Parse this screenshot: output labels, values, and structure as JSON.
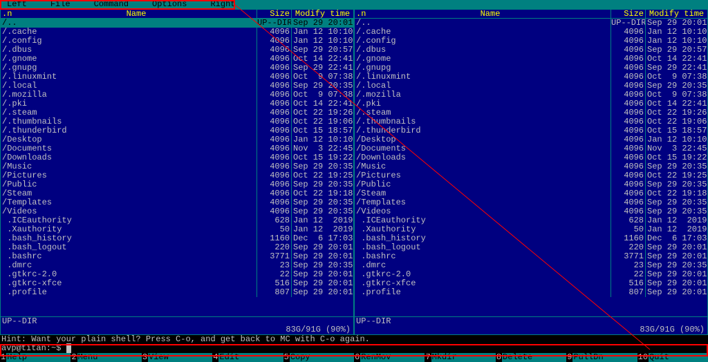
{
  "menu": [
    "Left",
    "File",
    "Command",
    "Options",
    "Right"
  ],
  "header": {
    "n": ".n",
    "name": "Name",
    "size": "Size",
    "date": "Modify time",
    "corner": ".[^]>"
  },
  "files": [
    {
      "name": "/..",
      "size": "UP--DIR",
      "date": "Sep 29 20:01",
      "sel": true
    },
    {
      "name": "/.cache",
      "size": "4096",
      "date": "Jan 12 10:10"
    },
    {
      "name": "/.config",
      "size": "4096",
      "date": "Jan 12 10:10"
    },
    {
      "name": "/.dbus",
      "size": "4096",
      "date": "Sep 29 20:57"
    },
    {
      "name": "/.gnome",
      "size": "4096",
      "date": "Oct 14 22:41"
    },
    {
      "name": "/.gnupg",
      "size": "4096",
      "date": "Sep 29 22:41"
    },
    {
      "name": "/.linuxmint",
      "size": "4096",
      "date": "Oct  9 07:38"
    },
    {
      "name": "/.local",
      "size": "4096",
      "date": "Sep 29 20:35"
    },
    {
      "name": "/.mozilla",
      "size": "4096",
      "date": "Oct  9 07:38"
    },
    {
      "name": "/.pki",
      "size": "4096",
      "date": "Oct 14 22:41"
    },
    {
      "name": "/.steam",
      "size": "4096",
      "date": "Oct 22 19:26"
    },
    {
      "name": "/.thumbnails",
      "size": "4096",
      "date": "Oct 22 19:06"
    },
    {
      "name": "/.thunderbird",
      "size": "4096",
      "date": "Oct 15 18:57"
    },
    {
      "name": "/Desktop",
      "size": "4096",
      "date": "Jan 12 10:10"
    },
    {
      "name": "/Documents",
      "size": "4096",
      "date": "Nov  3 22:45"
    },
    {
      "name": "/Downloads",
      "size": "4096",
      "date": "Oct 15 19:22"
    },
    {
      "name": "/Music",
      "size": "4096",
      "date": "Sep 29 20:35"
    },
    {
      "name": "/Pictures",
      "size": "4096",
      "date": "Oct 22 19:25"
    },
    {
      "name": "/Public",
      "size": "4096",
      "date": "Sep 29 20:35"
    },
    {
      "name": "/Steam",
      "size": "4096",
      "date": "Oct 22 19:18"
    },
    {
      "name": "/Templates",
      "size": "4096",
      "date": "Sep 29 20:35"
    },
    {
      "name": "/Videos",
      "size": "4096",
      "date": "Sep 29 20:35"
    },
    {
      "name": " .ICEauthority",
      "size": "628",
      "date": "Jan 12  2019"
    },
    {
      "name": " .Xauthority",
      "size": "50",
      "date": "Jan 12  2019"
    },
    {
      "name": " .bash_history",
      "size": "1160",
      "date": "Dec  6 17:03"
    },
    {
      "name": " .bash_logout",
      "size": "220",
      "date": "Sep 29 20:01"
    },
    {
      "name": " .bashrc",
      "size": "3771",
      "date": "Sep 29 20:01"
    },
    {
      "name": " .dmrc",
      "size": "23",
      "date": "Sep 29 20:35"
    },
    {
      "name": " .gtkrc-2.0",
      "size": "22",
      "date": "Sep 29 20:01"
    },
    {
      "name": " .gtkrc-xfce",
      "size": "516",
      "date": "Sep 29 20:01"
    },
    {
      "name": " .profile",
      "size": "807",
      "date": "Sep 29 20:01"
    }
  ],
  "footer": {
    "updir": "UP--DIR",
    "stats": "83G/91G (90%)"
  },
  "hint": "Hint: Want your plain shell? Press C-o, and get back to MC with C-o again.",
  "prompt": "avp@titan:~$ ",
  "fkeys": [
    {
      "n": "1",
      "l": "Help"
    },
    {
      "n": "2",
      "l": "Menu"
    },
    {
      "n": "3",
      "l": "View"
    },
    {
      "n": "4",
      "l": "Edit"
    },
    {
      "n": "5",
      "l": "Copy"
    },
    {
      "n": "6",
      "l": "RenMov"
    },
    {
      "n": "7",
      "l": "Mkdir"
    },
    {
      "n": "8",
      "l": "Delete"
    },
    {
      "n": "9",
      "l": "PullDn"
    },
    {
      "n": "10",
      "l": "Quit"
    }
  ]
}
